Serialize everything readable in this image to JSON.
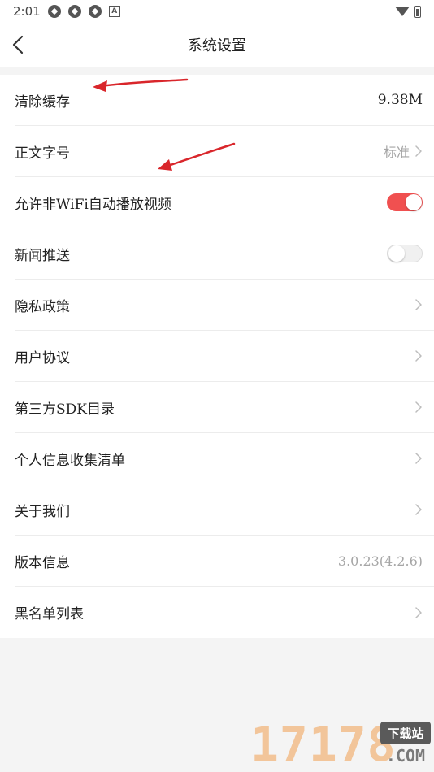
{
  "status_bar": {
    "time": "2:01",
    "icons": [
      "app-icon",
      "app-icon",
      "app-icon",
      "a-icon"
    ],
    "a_label": "A",
    "right_icons": [
      "wifi-icon",
      "battery-icon"
    ]
  },
  "nav": {
    "title": "系统设置",
    "back_icon": "chevron-left-icon"
  },
  "settings": {
    "clear_cache": {
      "label": "清除缓存",
      "value": "9.38M"
    },
    "font_size": {
      "label": "正文字号",
      "value": "标准"
    },
    "autoplay": {
      "label": "允许非WiFi自动播放视频",
      "enabled": true
    },
    "push": {
      "label": "新闻推送",
      "enabled": false
    },
    "privacy": {
      "label": "隐私政策"
    },
    "agreement": {
      "label": "用户协议"
    },
    "sdk": {
      "label": "第三方SDK目录"
    },
    "personal_info": {
      "label": "个人信息收集清单"
    },
    "about": {
      "label": "关于我们"
    },
    "version": {
      "label": "版本信息",
      "value": "3.0.23(4.2.6)"
    },
    "blacklist": {
      "label": "黑名单列表"
    }
  },
  "colors": {
    "accent": "#f05050",
    "annotation_arrow": "#d9262b"
  },
  "watermark": {
    "digits": "17178",
    "badge": "下载站",
    "domain": ".COM"
  }
}
